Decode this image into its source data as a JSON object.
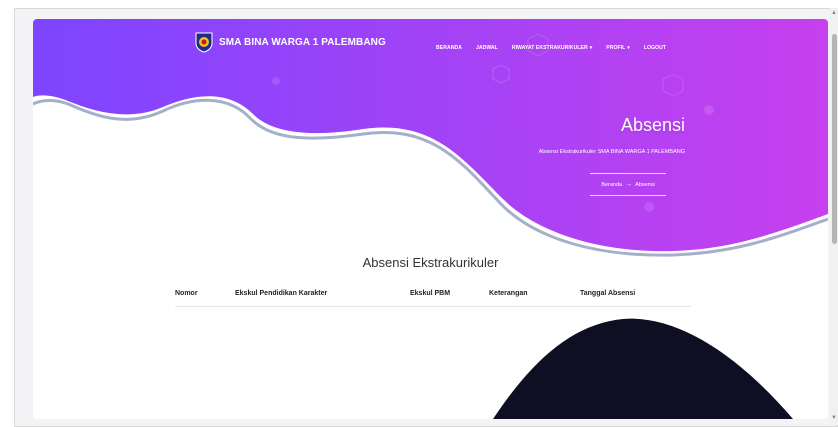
{
  "brand": {
    "name": "SMA BINA WARGA 1 PALEMBANG"
  },
  "nav": {
    "items": [
      {
        "label": "BERANDA",
        "caret": ""
      },
      {
        "label": "JADWAL",
        "caret": ""
      },
      {
        "label": "RIWAYAT EKSTRAKURIKULER",
        "caret": "▾"
      },
      {
        "label": "PROFIL",
        "caret": "▾"
      },
      {
        "label": "LOGOUT",
        "caret": ""
      }
    ]
  },
  "hero": {
    "title": "Absensi",
    "subtitle": "Absensi Ekstrakurikuler SMA BINA WARGA 1 PALEMBANG",
    "breadcrumb": {
      "home": "Beranda",
      "current": "Absensi"
    }
  },
  "section": {
    "title": "Absensi Ekstrakurikuler"
  },
  "table": {
    "columns": [
      "Nomor",
      "Ekskul Pendidikan Karakter",
      "Ekskul PBM",
      "Keterangan",
      "Tanggal Absensi"
    ]
  },
  "colors": {
    "gradient_start": "#7d45ff",
    "gradient_end": "#c640ee",
    "wave_shadow": "#9aa7c4",
    "dark_shape": "#0e0f22"
  }
}
